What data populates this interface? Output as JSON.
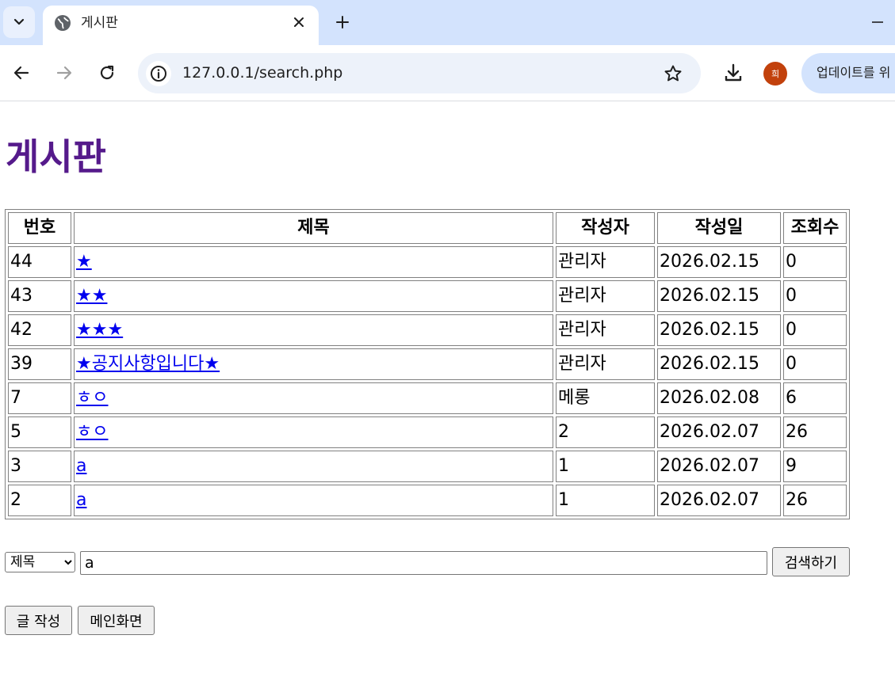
{
  "browser": {
    "tab_title": "게시판",
    "url": "127.0.0.1/search.php",
    "avatar_initial": "희",
    "update_label": "업데이트를 위"
  },
  "page": {
    "title": "게시판"
  },
  "table": {
    "headers": {
      "no": "번호",
      "title": "제목",
      "author": "작성자",
      "date": "작성일",
      "views": "조회수"
    },
    "rows": [
      {
        "no": "44",
        "title": "★",
        "author": "관리자",
        "date": "2026.02.15",
        "views": "0"
      },
      {
        "no": "43",
        "title": "★★",
        "author": "관리자",
        "date": "2026.02.15",
        "views": "0"
      },
      {
        "no": "42",
        "title": "★★★",
        "author": "관리자",
        "date": "2026.02.15",
        "views": "0"
      },
      {
        "no": "39",
        "title": "★공지사항입니다★",
        "author": "관리자",
        "date": "2026.02.15",
        "views": "0"
      },
      {
        "no": "7",
        "title": "ㅎㅇ",
        "author": "메롱",
        "date": "2026.02.08",
        "views": "6"
      },
      {
        "no": "5",
        "title": "ㅎㅇ",
        "author": "2",
        "date": "2026.02.07",
        "views": "26"
      },
      {
        "no": "3",
        "title": "a",
        "author": "1",
        "date": "2026.02.07",
        "views": "9"
      },
      {
        "no": "2",
        "title": "a",
        "author": "1",
        "date": "2026.02.07",
        "views": "26"
      }
    ]
  },
  "search": {
    "type_selected": "제목",
    "query": "a",
    "button_label": "검색하기"
  },
  "actions": {
    "write_label": "글 작성",
    "main_label": "메인화면"
  },
  "colors": {
    "title": "#551a8b",
    "link": "#0000ee",
    "tabstrip": "#d3e3fd",
    "avatar": "#c2410c"
  }
}
